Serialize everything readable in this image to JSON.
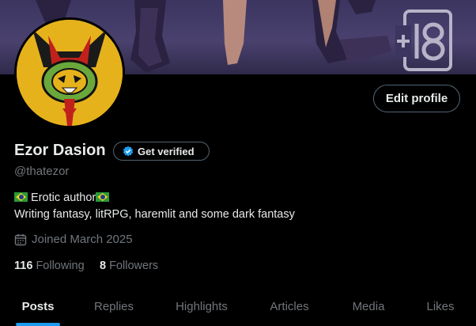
{
  "banner": {
    "rating_badge": "+18"
  },
  "profile": {
    "edit_label": "Edit profile",
    "name": "Ezor Dasion",
    "verify_label": "Get verified",
    "handle": "@thatezor",
    "bio_line1": "Erotic author",
    "bio_line2": "Writing fantasy, litRPG, haremlit and some dark fantasy",
    "joined": "Joined March 2025",
    "following_count": "116",
    "following_label": "Following",
    "followers_count": "8",
    "followers_label": "Followers"
  },
  "tabs": [
    {
      "label": "Posts",
      "active": true
    },
    {
      "label": "Replies"
    },
    {
      "label": "Highlights"
    },
    {
      "label": "Articles"
    },
    {
      "label": "Media"
    },
    {
      "label": "Likes"
    }
  ],
  "colors": {
    "accent": "#1d9bf0",
    "muted": "#71767b",
    "text": "#e7e9ea",
    "border": "#536471"
  },
  "icons": [
    "verified-badge-icon",
    "calendar-icon",
    "brazil-flag-icon"
  ]
}
